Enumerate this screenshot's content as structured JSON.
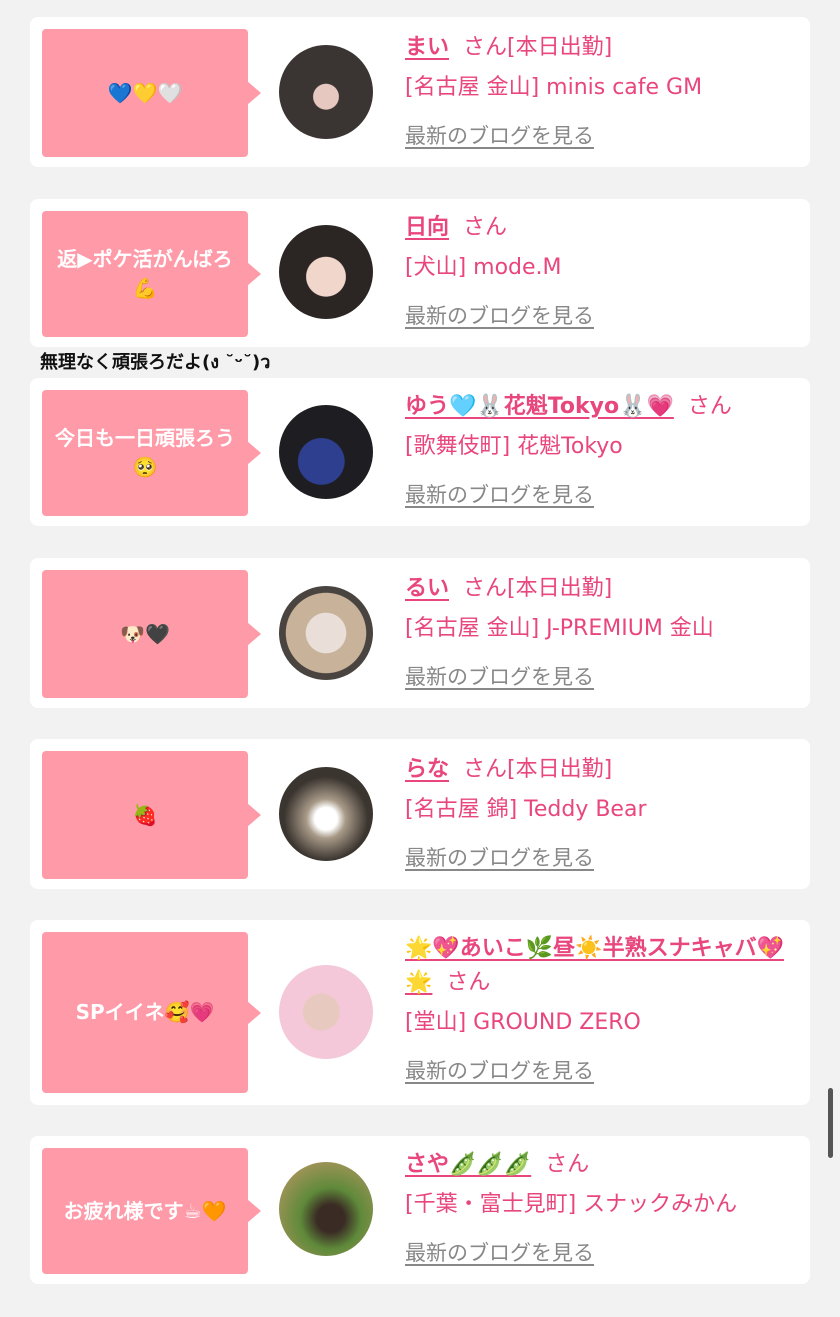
{
  "entries": [
    {
      "message": "💙💛🤍",
      "name": "まい",
      "san": "さん",
      "status": "[本日出勤]",
      "shop": "[名古屋 金山] minis cafe GM",
      "blog": "最新のブログを見る"
    },
    {
      "message": "返▶ポケ活がんばろ💪",
      "name": "日向",
      "san": "さん",
      "status": "",
      "shop": "[犬山] mode.M",
      "blog": "最新のブログを見る"
    },
    {
      "message": "今日も一日頑張ろう🥺",
      "name": "ゆう🩵🐰花魁Tokyo🐰💗",
      "san": "さん",
      "status": "",
      "shop": "[歌舞伎町] 花魁Tokyo",
      "blog": "最新のブログを見る"
    },
    {
      "message": "🐶🖤",
      "name": "るい",
      "san": "さん",
      "status": "[本日出勤]",
      "shop": "[名古屋 金山] J-PREMIUM 金山",
      "blog": "最新のブログを見る"
    },
    {
      "message": "🍓",
      "name": "らな",
      "san": "さん",
      "status": "[本日出勤]",
      "shop": "[名古屋 錦] Teddy Bear",
      "blog": "最新のブログを見る"
    },
    {
      "message": "SPイイネ🥰💗",
      "name": "🌟💖あいこ🌿昼☀️半熟スナキャバ💖🌟",
      "san": "さん",
      "status": "",
      "shop": "[堂山] GROUND ZERO",
      "blog": "最新のブログを見る"
    },
    {
      "message": "お疲れ様です☕🧡",
      "name": "さや🫛🫛🫛",
      "san": "さん",
      "status": "",
      "shop": "[千葉・富士見町] スナックみかん",
      "blog": "最新のブログを見る"
    }
  ],
  "caption": "無理なく頑張ろだよ(ง ˘ᵕ˘)ว",
  "colors": {
    "bubble": "#ff9aa8",
    "link": "#e8467c",
    "background": "#f2f2f2"
  }
}
